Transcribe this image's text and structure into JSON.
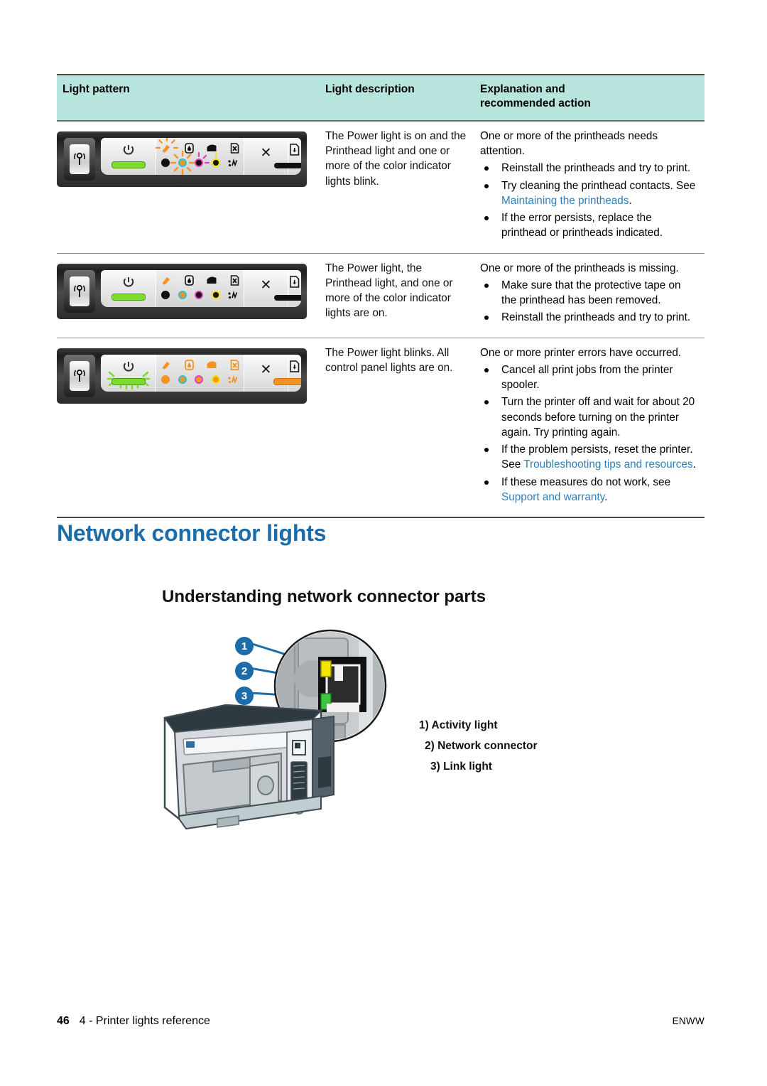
{
  "table": {
    "headers": [
      "Light pattern",
      "Light description",
      "Explanation and\nrecommended action"
    ],
    "header_line1": "Explanation and",
    "header_line2": "recommended action",
    "rows": [
      {
        "panel_state": "power-on-printhead-blink",
        "description": "The Power light is on and the Printhead light and one or more of the color indicator lights blink.",
        "explanation": "One or more of the printheads needs attention.",
        "actions": [
          {
            "text": "Reinstall the printheads and try to print."
          },
          {
            "text_before": "Try cleaning the printhead contacts. See ",
            "link": "Maintaining the printheads",
            "text_after": "."
          },
          {
            "text": "If the error persists, replace the printhead or printheads indicated."
          }
        ]
      },
      {
        "panel_state": "power-on-printhead-on",
        "description": "The Power light, the Printhead light, and one or more of the color indicator lights are on.",
        "explanation": "One or more of the printheads is missing.",
        "actions": [
          {
            "text": "Make sure that the protective tape on the printhead has been removed."
          },
          {
            "text": "Reinstall the printheads and try to print."
          }
        ]
      },
      {
        "panel_state": "power-blink-all-on",
        "description": "The Power light blinks. All control panel lights are on.",
        "explanation": "One or more printer errors have occurred.",
        "actions": [
          {
            "text": "Cancel all print jobs from the printer spooler."
          },
          {
            "text": "Turn the printer off and wait for about 20 seconds before turning on the printer again. Try printing again."
          },
          {
            "text_before": "If the problem persists, reset the printer. See ",
            "link": "Troubleshooting tips and resources",
            "text_after": "."
          },
          {
            "text_before": "If these measures do not work, see ",
            "link": "Support and warranty",
            "text_after": "."
          }
        ]
      }
    ]
  },
  "headings": {
    "h1": "Network connector lights",
    "h2": "Understanding network connector parts"
  },
  "figure": {
    "callouts": [
      "1",
      "2",
      "3"
    ],
    "legend": [
      "1) Activity light",
      "2) Network connector",
      "3) Link light"
    ],
    "activity_light_color": "#f2e500",
    "link_light_color": "#3fc43f",
    "callout_color": "#1b6ca8"
  },
  "footer": {
    "page_number": "46",
    "chapter": "4 - Printer lights reference",
    "locale": "ENWW"
  },
  "colors": {
    "header_bg": "#b7e4dd",
    "heading_blue": "#1b6ca8",
    "link_blue": "#2f7fb8",
    "power_green": "#7ddc2f",
    "amber": "#f59322"
  }
}
